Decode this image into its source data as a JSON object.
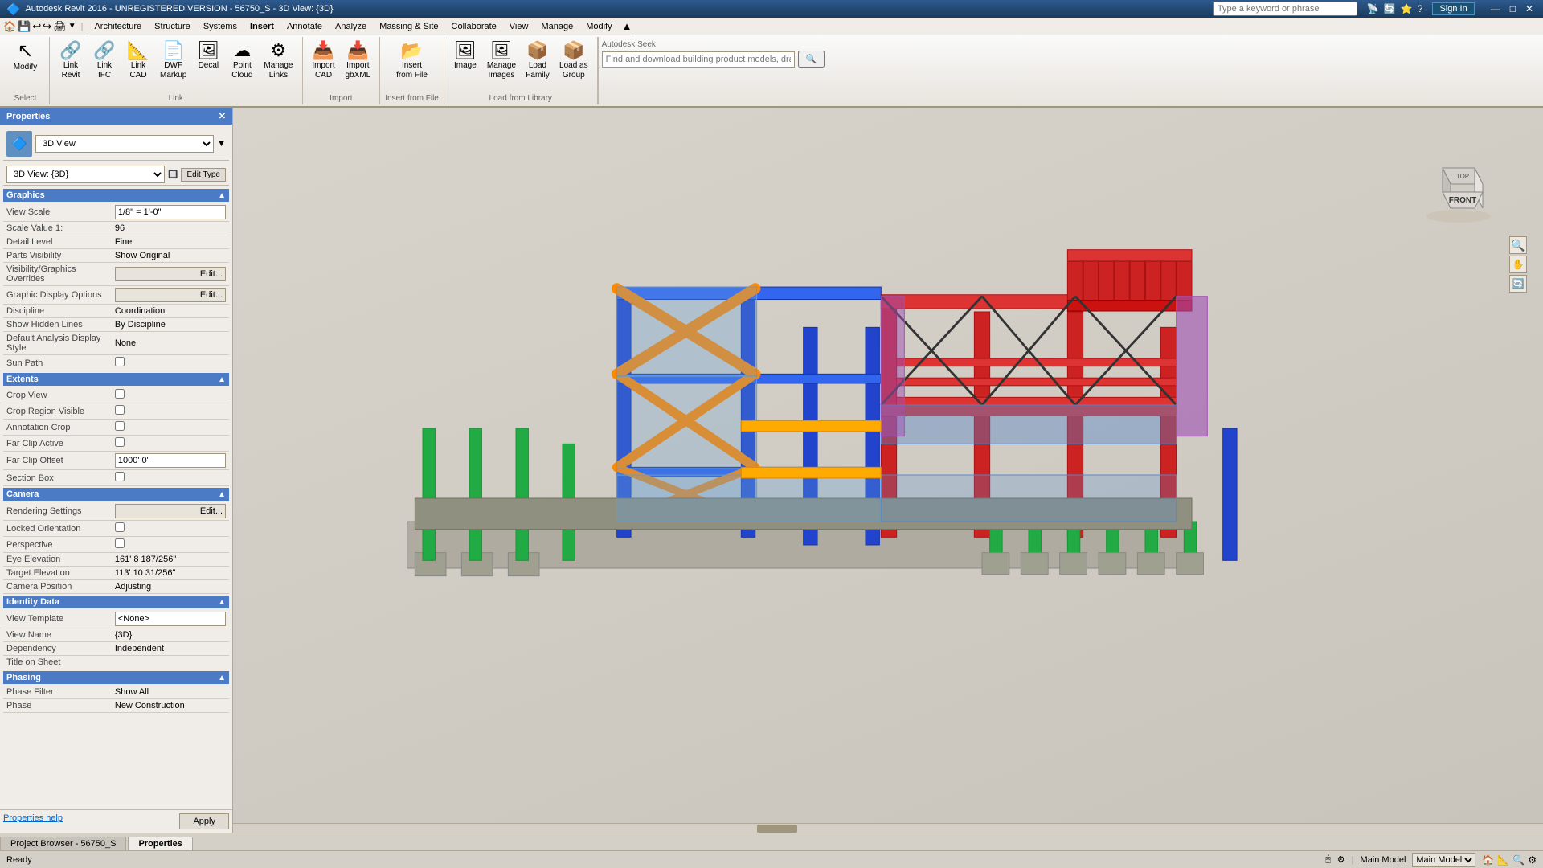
{
  "titlebar": {
    "title": "Autodesk Revit 2016 - UNREGISTERED VERSION -  56750_S - 3D View: {3D}",
    "minimize": "—",
    "maximize": "□",
    "close": "✕",
    "help_icon": "?",
    "sign_in": "Sign In"
  },
  "quick_access": {
    "buttons": [
      "🏠",
      "💾",
      "↩",
      "↪",
      "⬅",
      "➡",
      "🖨",
      "🔍",
      "⚙"
    ]
  },
  "ribbon": {
    "tabs": [
      "Architecture",
      "Structure",
      "Systems",
      "Insert",
      "Annotate",
      "Analyze",
      "Massing & Site",
      "Collaborate",
      "View",
      "Manage",
      "Modify"
    ],
    "active_tab": "Insert",
    "groups": [
      {
        "name": "Link",
        "items": [
          {
            "label": "Modify",
            "icon": "↖"
          },
          {
            "label": "Link\nRevit",
            "icon": "🔗"
          },
          {
            "label": "Link\nIFC",
            "icon": "🔗"
          },
          {
            "label": "Link\nCAD",
            "icon": "📐"
          },
          {
            "label": "DWF\nMarkup",
            "icon": "📄"
          },
          {
            "label": "Decal",
            "icon": "🖼"
          },
          {
            "label": "Point\nCloud",
            "icon": "☁"
          },
          {
            "label": "Manage\nLinks",
            "icon": "⚙"
          }
        ]
      },
      {
        "name": "Import",
        "items": [
          {
            "label": "Import\nCAD",
            "icon": "📥"
          },
          {
            "label": "Import\ngbXML",
            "icon": "📥"
          }
        ]
      },
      {
        "name": "Insert from File",
        "items": [
          {
            "label": "Insert\nfrom File",
            "icon": "📂"
          }
        ]
      },
      {
        "name": "Load from Library",
        "items": [
          {
            "label": "Image",
            "icon": "🖼"
          },
          {
            "label": "Manage\nImages",
            "icon": "🖼"
          },
          {
            "label": "Load\nFamily",
            "icon": "📦"
          },
          {
            "label": "Load as\nGroup",
            "icon": "📦"
          }
        ]
      },
      {
        "name": "Autodesk Seek",
        "items": [],
        "seek_placeholder": "Find and download building product models, drawings, and specs"
      }
    ],
    "search_placeholder": "Type a keyword or phrase"
  },
  "properties": {
    "title": "Properties",
    "close_icon": "✕",
    "type_icon": "🔷",
    "type_name": "3D View",
    "view_name": "3D View: {3D}",
    "edit_type_label": "Edit Type",
    "sections": [
      {
        "name": "Graphics",
        "expanded": true,
        "rows": [
          {
            "label": "View Scale",
            "value": "1/8\" = 1'-0\"",
            "editable": true
          },
          {
            "label": "Scale Value  1:",
            "value": "96",
            "editable": false
          },
          {
            "label": "Detail Level",
            "value": "Fine",
            "editable": false
          },
          {
            "label": "Parts Visibility",
            "value": "Show Original",
            "editable": false
          },
          {
            "label": "Visibility/Graphics Overrides",
            "value": "Edit...",
            "type": "button"
          },
          {
            "label": "Graphic Display Options",
            "value": "Edit...",
            "type": "button"
          },
          {
            "label": "Discipline",
            "value": "Coordination",
            "editable": false
          },
          {
            "label": "Show Hidden Lines",
            "value": "By Discipline",
            "editable": false
          },
          {
            "label": "Default Analysis Display Style",
            "value": "None",
            "editable": false
          },
          {
            "label": "Sun Path",
            "value": "",
            "type": "checkbox"
          }
        ]
      },
      {
        "name": "Extents",
        "expanded": true,
        "rows": [
          {
            "label": "Crop View",
            "value": "",
            "type": "checkbox"
          },
          {
            "label": "Crop Region Visible",
            "value": "",
            "type": "checkbox"
          },
          {
            "label": "Annotation Crop",
            "value": "",
            "type": "checkbox"
          },
          {
            "label": "Far Clip Active",
            "value": "",
            "type": "checkbox"
          },
          {
            "label": "Far Clip Offset",
            "value": "1000' 0\"",
            "editable": true
          },
          {
            "label": "Section Box",
            "value": "",
            "type": "checkbox"
          }
        ]
      },
      {
        "name": "Camera",
        "expanded": true,
        "rows": [
          {
            "label": "Rendering Settings",
            "value": "Edit...",
            "type": "button"
          },
          {
            "label": "Locked Orientation",
            "value": "",
            "type": "checkbox"
          },
          {
            "label": "Perspective",
            "value": "",
            "type": "checkbox"
          },
          {
            "label": "Eye Elevation",
            "value": "161' 8 187/256\"",
            "editable": false
          },
          {
            "label": "Target Elevation",
            "value": "113' 10 31/256\"",
            "editable": false
          },
          {
            "label": "Camera Position",
            "value": "Adjusting",
            "editable": false
          }
        ]
      },
      {
        "name": "Identity Data",
        "expanded": true,
        "rows": [
          {
            "label": "View Template",
            "value": "<None>",
            "editable": true
          },
          {
            "label": "View Name",
            "value": "{3D}",
            "editable": false
          },
          {
            "label": "Dependency",
            "value": "Independent",
            "editable": false
          },
          {
            "label": "Title on Sheet",
            "value": "",
            "editable": false
          }
        ]
      },
      {
        "name": "Phasing",
        "expanded": true,
        "rows": [
          {
            "label": "Phase Filter",
            "value": "Show All",
            "editable": false
          },
          {
            "label": "Phase",
            "value": "New Construction",
            "editable": false
          }
        ]
      }
    ],
    "footer": {
      "help_link": "Properties help",
      "apply_btn": "Apply"
    }
  },
  "status_bar": {
    "status": "Ready",
    "model": "Main Model",
    "icons": [
      "🖱",
      "⚙",
      "📏",
      "🔍"
    ]
  },
  "bottom_tabs": [
    {
      "label": "Project Browser - 56750_S",
      "active": false
    },
    {
      "label": "Properties",
      "active": true
    }
  ],
  "viewcube": {
    "face": "FRONT"
  }
}
